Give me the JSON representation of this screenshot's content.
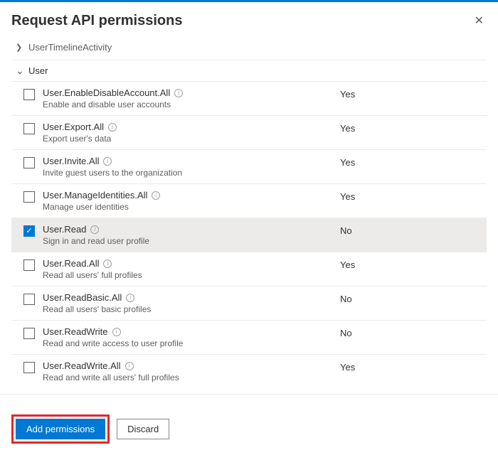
{
  "header": {
    "title": "Request API permissions",
    "close_glyph": "✕"
  },
  "groups": {
    "collapsed": {
      "label": "UserTimelineActivity",
      "chevron": "❯"
    },
    "expanded": {
      "label": "User",
      "chevron": "⌄"
    }
  },
  "permissions": [
    {
      "name": "User.EnableDisableAccount.All",
      "desc": "Enable and disable user accounts",
      "admin": "Yes",
      "checked": false
    },
    {
      "name": "User.Export.All",
      "desc": "Export user's data",
      "admin": "Yes",
      "checked": false
    },
    {
      "name": "User.Invite.All",
      "desc": "Invite guest users to the organization",
      "admin": "Yes",
      "checked": false
    },
    {
      "name": "User.ManageIdentities.All",
      "desc": "Manage user identities",
      "admin": "Yes",
      "checked": false
    },
    {
      "name": "User.Read",
      "desc": "Sign in and read user profile",
      "admin": "No",
      "checked": true
    },
    {
      "name": "User.Read.All",
      "desc": "Read all users' full profiles",
      "admin": "Yes",
      "checked": false
    },
    {
      "name": "User.ReadBasic.All",
      "desc": "Read all users' basic profiles",
      "admin": "No",
      "checked": false
    },
    {
      "name": "User.ReadWrite",
      "desc": "Read and write access to user profile",
      "admin": "No",
      "checked": false
    },
    {
      "name": "User.ReadWrite.All",
      "desc": "Read and write all users' full profiles",
      "admin": "Yes",
      "checked": false
    }
  ],
  "footer": {
    "add_label": "Add permissions",
    "discard_label": "Discard"
  },
  "glyphs": {
    "check": "✓",
    "info": "i"
  }
}
